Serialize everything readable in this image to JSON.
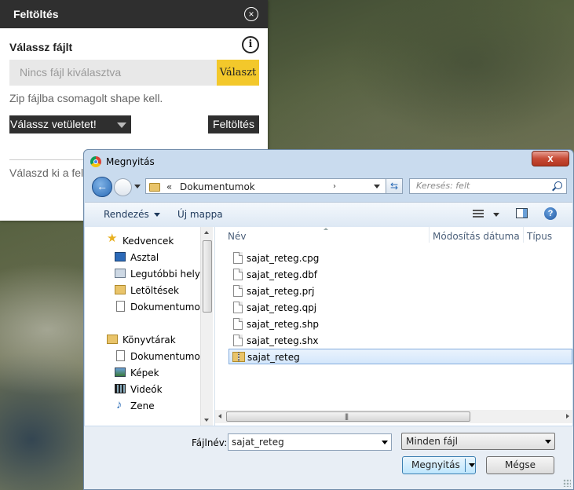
{
  "upload_panel": {
    "title": "Feltöltés",
    "close_icon": "close-circle-icon",
    "choose_file_label": "Válassz fájlt",
    "info_icon": "info-icon",
    "file_input_placeholder": "Nincs fájl kiválasztva",
    "choose_button": "Választ",
    "hint": "Zip fájlba csomagolt shape kell.",
    "projection_select": "Válassz vetületet!",
    "upload_button": "Feltöltés",
    "bottom_text": "Válaszd ki a fel"
  },
  "dialog": {
    "title": "Megnyitás",
    "close_label": "x",
    "address": {
      "chevron": "«",
      "path": "Dokumentumok",
      "after": "›"
    },
    "search_placeholder": "Keresés: felt",
    "toolbar": {
      "organize": "Rendezés",
      "new_folder": "Új mappa"
    },
    "nav": {
      "favorites": "Kedvencek",
      "favorites_items": [
        "Asztal",
        "Legutóbbi helyek",
        "Letöltések",
        "Dokumentumok"
      ],
      "libraries": "Könyvtárak",
      "libraries_items": [
        "Dokumentumok",
        "Képek",
        "Videók",
        "Zene"
      ]
    },
    "columns": {
      "name": "Név",
      "modified": "Módosítás dátuma",
      "type": "Típus"
    },
    "files": [
      {
        "name": "sajat_reteg.cpg",
        "icon": "document-icon"
      },
      {
        "name": "sajat_reteg.dbf",
        "icon": "document-icon"
      },
      {
        "name": "sajat_reteg.prj",
        "icon": "document-icon"
      },
      {
        "name": "sajat_reteg.qpj",
        "icon": "document-icon"
      },
      {
        "name": "sajat_reteg.shp",
        "icon": "document-icon"
      },
      {
        "name": "sajat_reteg.shx",
        "icon": "document-icon"
      },
      {
        "name": "sajat_reteg",
        "icon": "zip-folder-icon",
        "selected": true
      }
    ],
    "filename_label": "Fájlnév:",
    "filename_value": "sajat_reteg",
    "filter_value": "Minden fájl",
    "open_button": "Megnyitás",
    "cancel_button": "Mégse"
  }
}
